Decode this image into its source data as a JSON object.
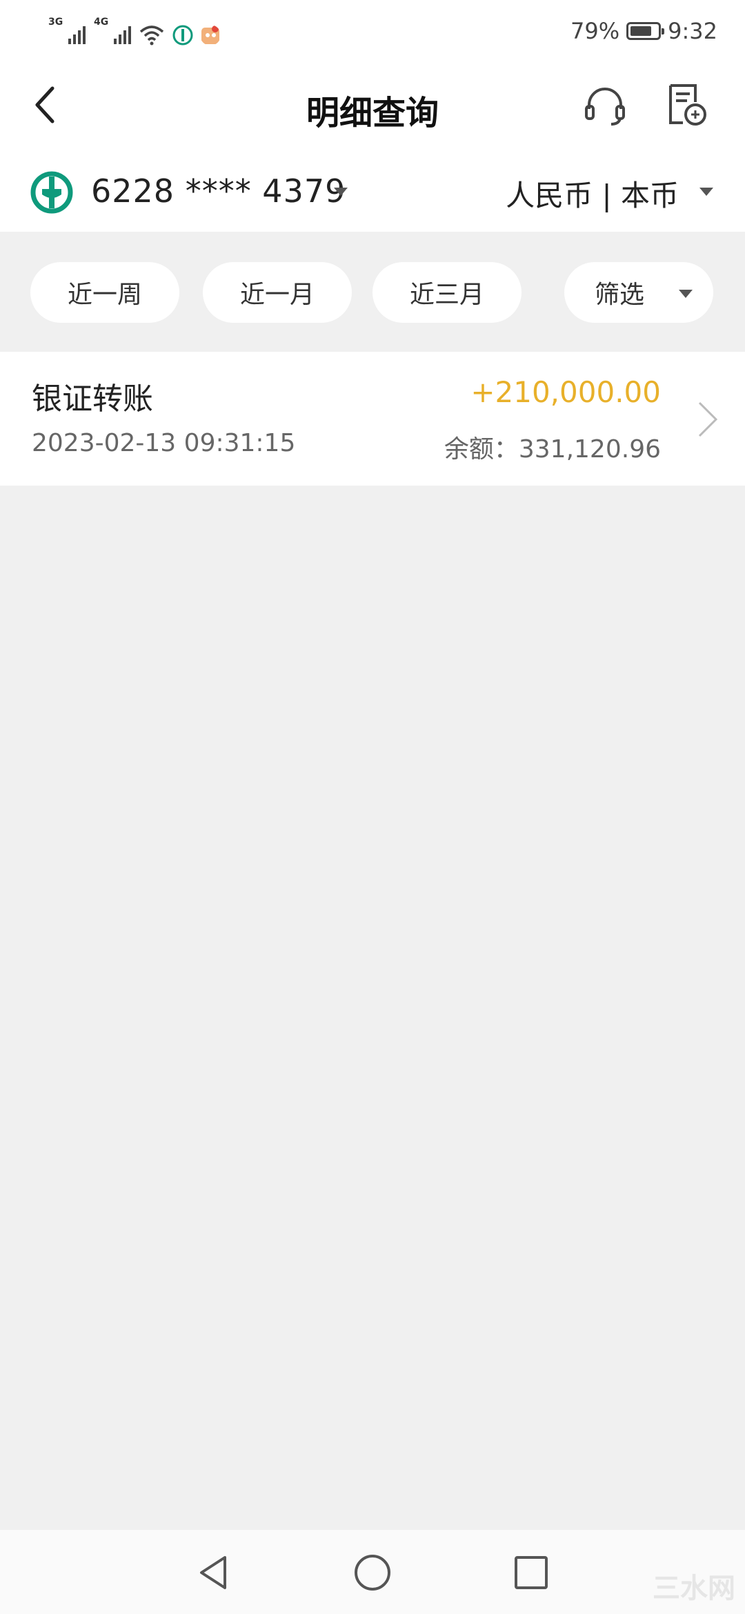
{
  "status_bar": {
    "network_1": "3G",
    "network_2": "4G",
    "battery_percent": "79%",
    "battery_level": 0.79,
    "time": "9:32"
  },
  "header": {
    "title": "明细查询",
    "back_icon": "chevron-left-icon",
    "service_icon": "headset-icon",
    "export_icon": "document-export-icon"
  },
  "account": {
    "number": "6228 **** 4379",
    "currency": "人民币 | 本币",
    "logo_color": "#0f9a7c"
  },
  "filters": {
    "week": "近一周",
    "month": "近一月",
    "three_months": "近三月",
    "filter": "筛选"
  },
  "transactions": [
    {
      "name": "银证转账",
      "amount": "+210,000.00",
      "time": "2023-02-13 09:31:15",
      "balance": "余额：331,120.96"
    }
  ],
  "colors": {
    "amount_positive": "#e8b02a",
    "background": "#f0f0f0"
  },
  "watermark": "三水网"
}
